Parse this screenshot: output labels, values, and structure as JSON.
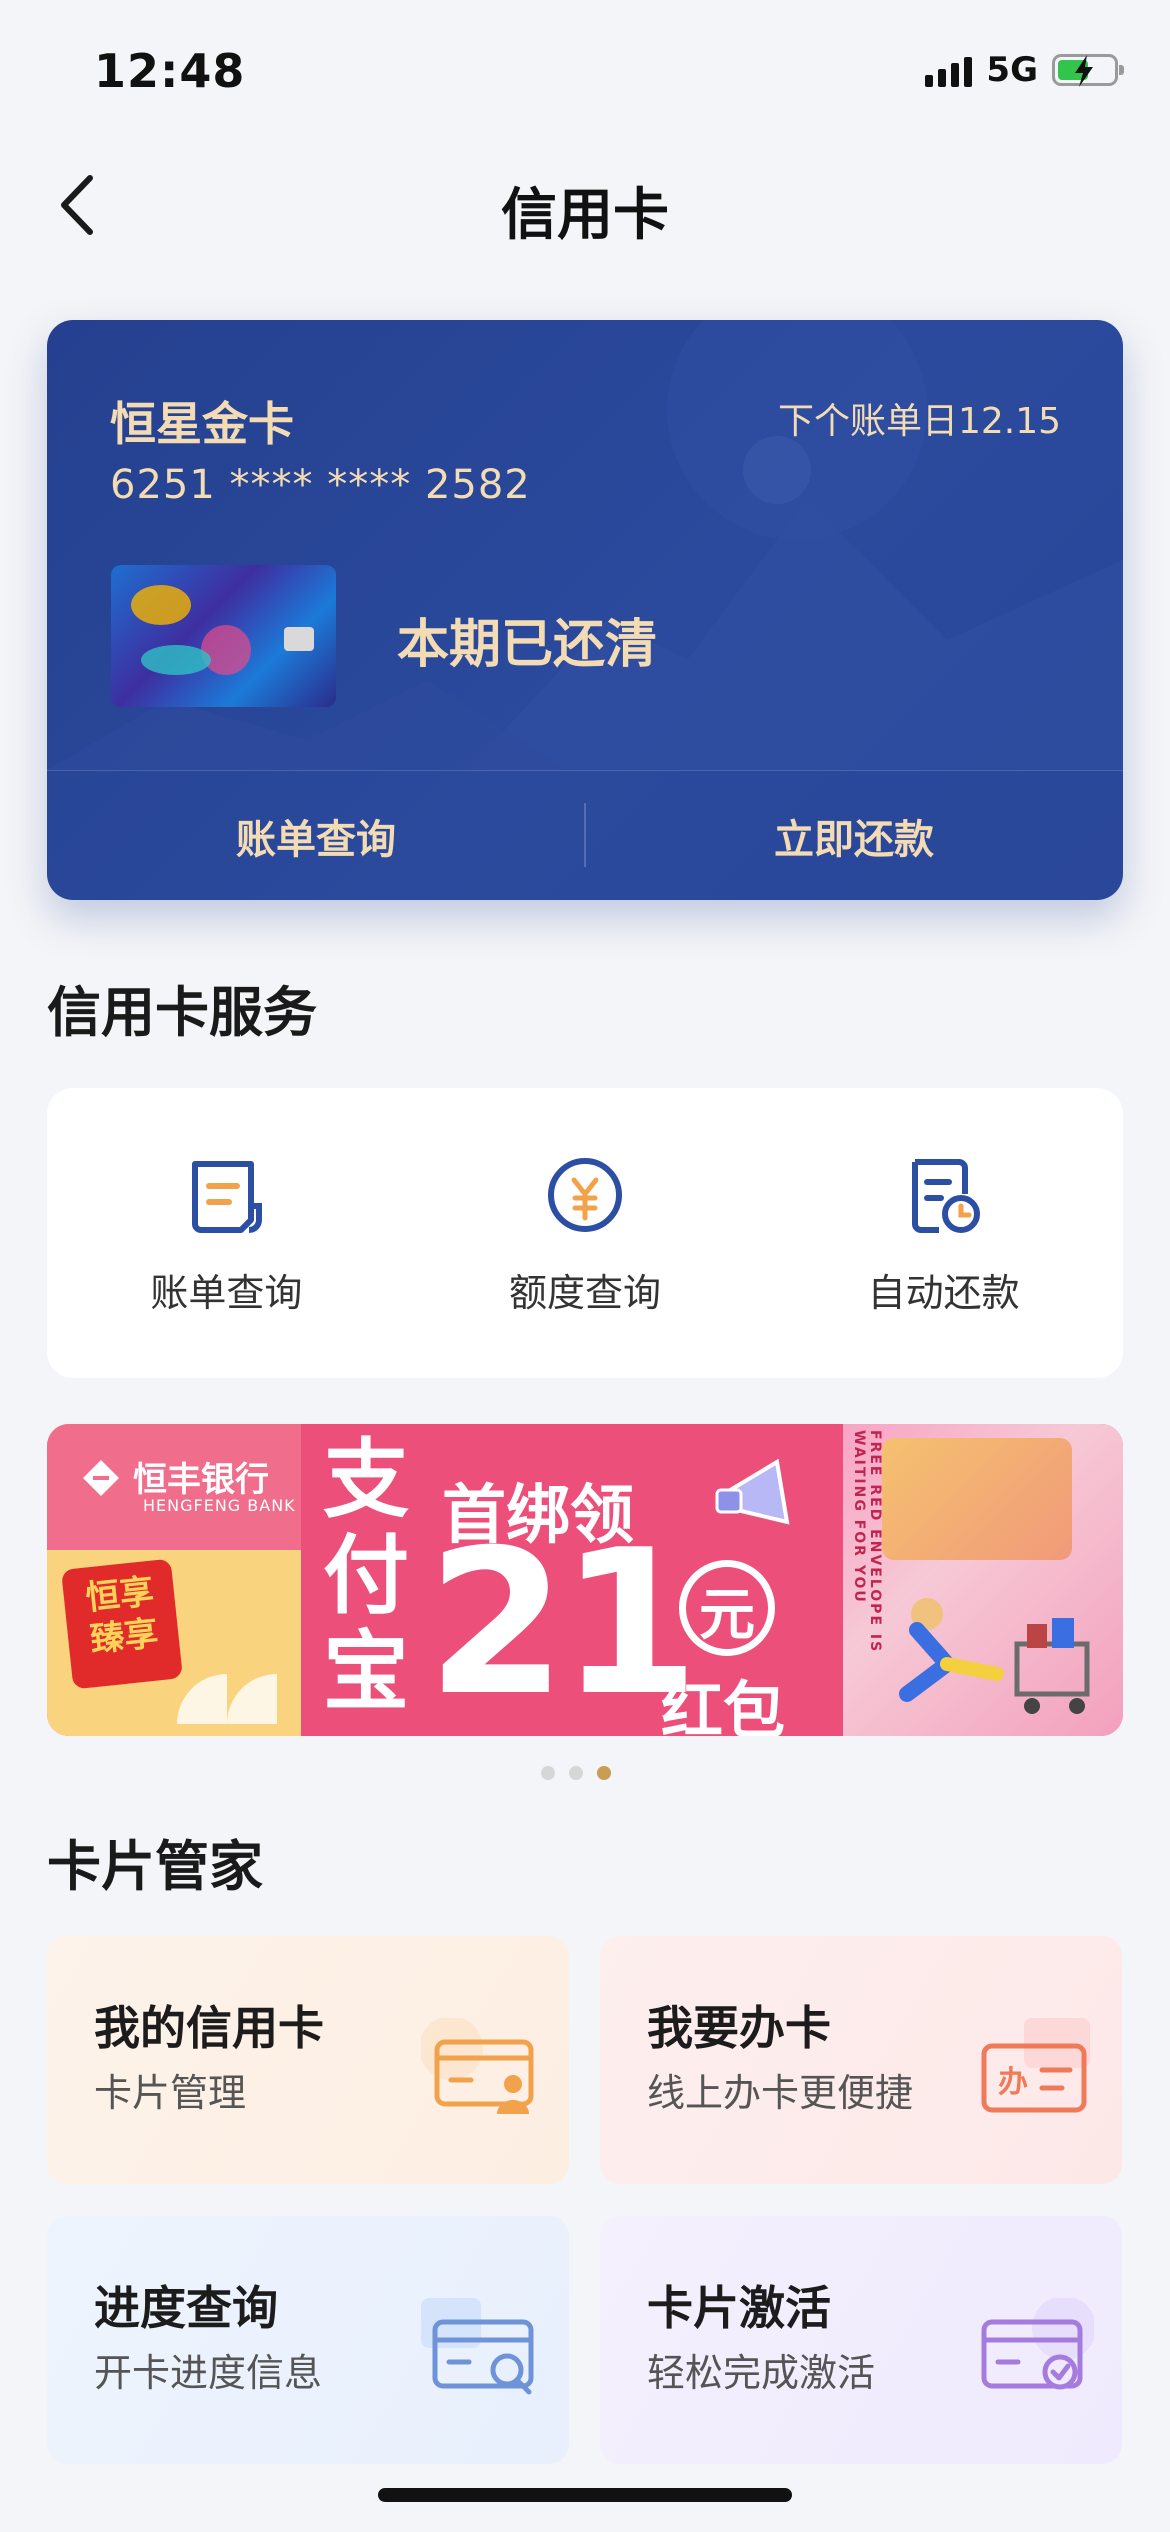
{
  "status_bar": {
    "time": "12:48",
    "network": "5G"
  },
  "nav": {
    "title": "信用卡"
  },
  "card": {
    "name": "恒星金卡",
    "number": "6251 **** **** 2582",
    "bill_day": "下个账单日12.15",
    "status": "本期已还清",
    "actions": [
      "账单查询",
      "立即还款"
    ]
  },
  "services_title": "信用卡服务",
  "services": [
    {
      "label": "账单查询",
      "icon": "bill-icon"
    },
    {
      "label": "额度查询",
      "icon": "credit-limit-icon"
    },
    {
      "label": "自动还款",
      "icon": "auto-repay-icon"
    }
  ],
  "banner": {
    "bank_name": "恒丰银行",
    "bank_name_en": "HENGFENG BANK",
    "badge": "恒享臻享",
    "pay": "支付宝",
    "headline": "首绑领",
    "amount": "21",
    "unit": "元",
    "reward": "红包",
    "vertical_text": "FREE RED ENVELOPE IS WAITING FOR YOU"
  },
  "carousel": {
    "count": 3,
    "active": 3
  },
  "manager_title": "卡片管家",
  "tiles": [
    {
      "title": "我的信用卡",
      "subtitle": "卡片管理",
      "icon": "card-user-icon",
      "accent": "#f2a24a"
    },
    {
      "title": "我要办卡",
      "subtitle": "线上办卡更便捷",
      "icon": "apply-card-icon",
      "accent": "#f07a57"
    },
    {
      "title": "进度查询",
      "subtitle": "开卡进度信息",
      "icon": "card-search-icon",
      "accent": "#6f93d8"
    },
    {
      "title": "卡片激活",
      "subtitle": "轻松完成激活",
      "icon": "card-activate-icon",
      "accent": "#a57be0"
    }
  ],
  "colors": {
    "card_bg": "#2b4a9d",
    "card_text": "#f3dcb3",
    "icon_blue": "#2d4fa3"
  }
}
